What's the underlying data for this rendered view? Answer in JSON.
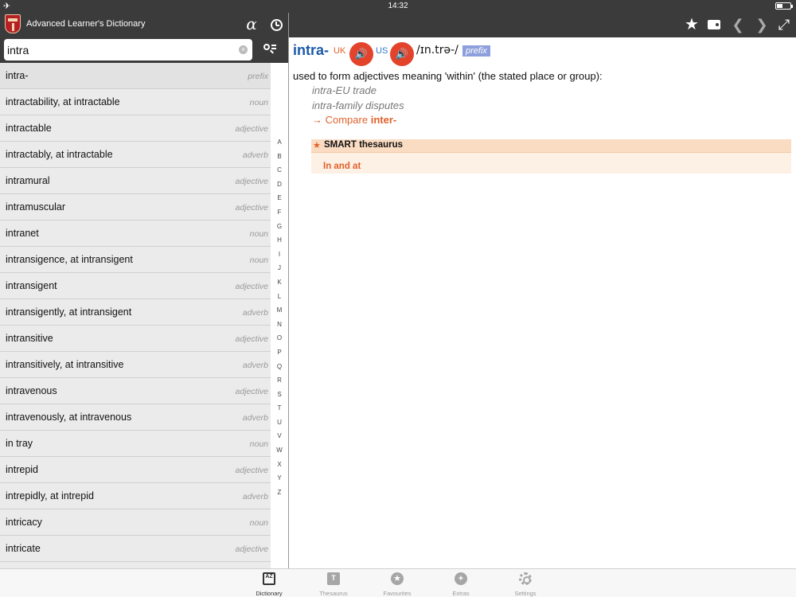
{
  "status": {
    "time": "14:32",
    "airplane_icon": "airplane-icon",
    "battery_level": 0.45
  },
  "header": {
    "app_title": "Advanced Learner's Dictionary",
    "alpha_glyph": "α",
    "star": "★",
    "back": "❮",
    "forward": "❯",
    "expand": "⤢"
  },
  "search": {
    "value": "intra",
    "placeholder": "",
    "clear": "×"
  },
  "wordlist": [
    {
      "word": "intra-",
      "pos": "prefix"
    },
    {
      "word": "intractability, at intractable",
      "pos": "noun"
    },
    {
      "word": "intractable",
      "pos": "adjective"
    },
    {
      "word": "intractably, at intractable",
      "pos": "adverb"
    },
    {
      "word": "intramural",
      "pos": "adjective"
    },
    {
      "word": "intramuscular",
      "pos": "adjective"
    },
    {
      "word": "intranet",
      "pos": "noun"
    },
    {
      "word": "intransigence, at intransigent",
      "pos": "noun"
    },
    {
      "word": "intransigent",
      "pos": "adjective"
    },
    {
      "word": "intransigently, at intransigent",
      "pos": "adverb"
    },
    {
      "word": "intransitive",
      "pos": "adjective"
    },
    {
      "word": "intransitively, at intransitive",
      "pos": "adverb"
    },
    {
      "word": "intravenous",
      "pos": "adjective"
    },
    {
      "word": "intravenously, at intravenous",
      "pos": "adverb"
    },
    {
      "word": "in tray",
      "pos": "noun"
    },
    {
      "word": "intrepid",
      "pos": "adjective"
    },
    {
      "word": "intrepidly, at intrepid",
      "pos": "adverb"
    },
    {
      "word": "intricacy",
      "pos": "noun"
    },
    {
      "word": "intricate",
      "pos": "adjective"
    },
    {
      "word": "",
      "pos": ""
    }
  ],
  "alphabet": [
    "A",
    "B",
    "C",
    "D",
    "E",
    "F",
    "G",
    "H",
    "I",
    "J",
    "K",
    "L",
    "M",
    "N",
    "O",
    "P",
    "Q",
    "R",
    "S",
    "T",
    "U",
    "V",
    "W",
    "X",
    "Y",
    "Z"
  ],
  "entry": {
    "headword": "intra-",
    "uk_label": "UK",
    "us_label": "US",
    "speaker_glyph": "🔊",
    "pronunciation": "/ɪn.trə-/",
    "pos": "prefix",
    "definition": "used to form adjectives meaning 'within' (the stated place or group):",
    "examples": [
      "intra-EU trade",
      "intra-family disputes"
    ],
    "compare_prefix": "→  Compare ",
    "compare_word": "inter-"
  },
  "thesaurus": {
    "star": "★",
    "title": "SMART thesaurus",
    "link": "In and at"
  },
  "tabs": [
    {
      "label": "Dictionary",
      "glyph": "AZ"
    },
    {
      "label": "Thesaurus",
      "glyph": "T"
    },
    {
      "label": "Favourites",
      "glyph": "★"
    },
    {
      "label": "Extras",
      "glyph": "+"
    },
    {
      "label": "Settings",
      "glyph": ""
    }
  ],
  "colors": {
    "dark_bar": "#3b3b3b",
    "headword_blue": "#1b5aa8",
    "accent_orange": "#e0612b",
    "speaker_red": "#e3422b",
    "pos_tag_blue": "#8d9fdc"
  }
}
